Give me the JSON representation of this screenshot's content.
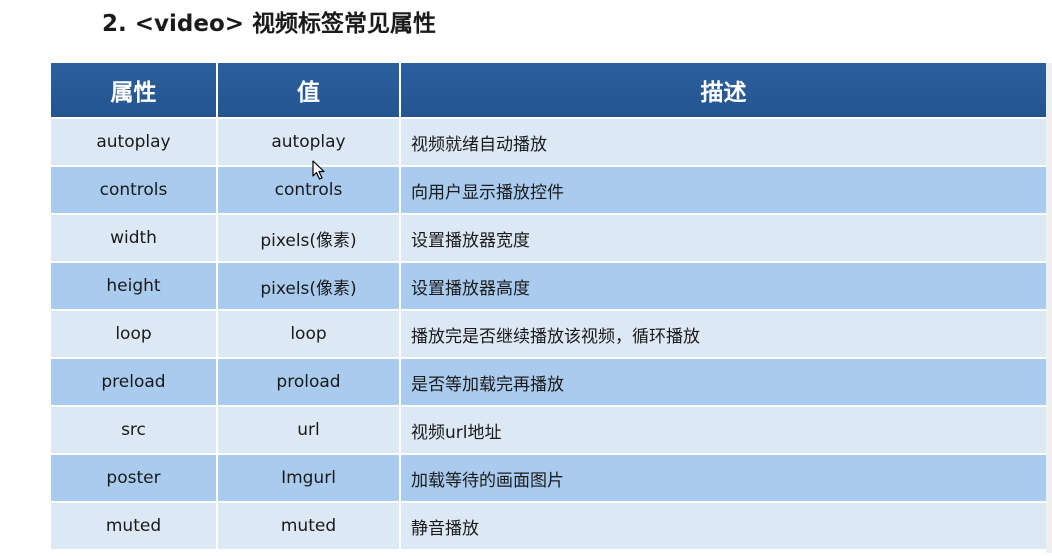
{
  "title": "2. <video> 视频标签常见属性",
  "table": {
    "headers": [
      "属性",
      "值",
      "描述"
    ],
    "rows": [
      [
        "autoplay",
        "autoplay",
        "视频就绪自动播放"
      ],
      [
        "controls",
        "controls",
        "向用户显示播放控件"
      ],
      [
        "width",
        "pixels(像素)",
        "设置播放器宽度"
      ],
      [
        "height",
        "pixels(像素)",
        "设置播放器高度"
      ],
      [
        "loop",
        "loop",
        "播放完是否继续播放该视频，循环播放"
      ],
      [
        "preload",
        "proload",
        "是否等加载完再播放"
      ],
      [
        "src",
        "url",
        "视频url地址"
      ],
      [
        "poster",
        "Imgurl",
        "加载等待的画面图片"
      ],
      [
        "muted",
        "muted",
        "静音播放"
      ]
    ]
  },
  "colors": {
    "header_bg": "#2b5f9e",
    "row_light": "#dde8f5",
    "row_dark": "#a9cbee"
  },
  "icons": [
    "mouse-cursor-icon"
  ]
}
